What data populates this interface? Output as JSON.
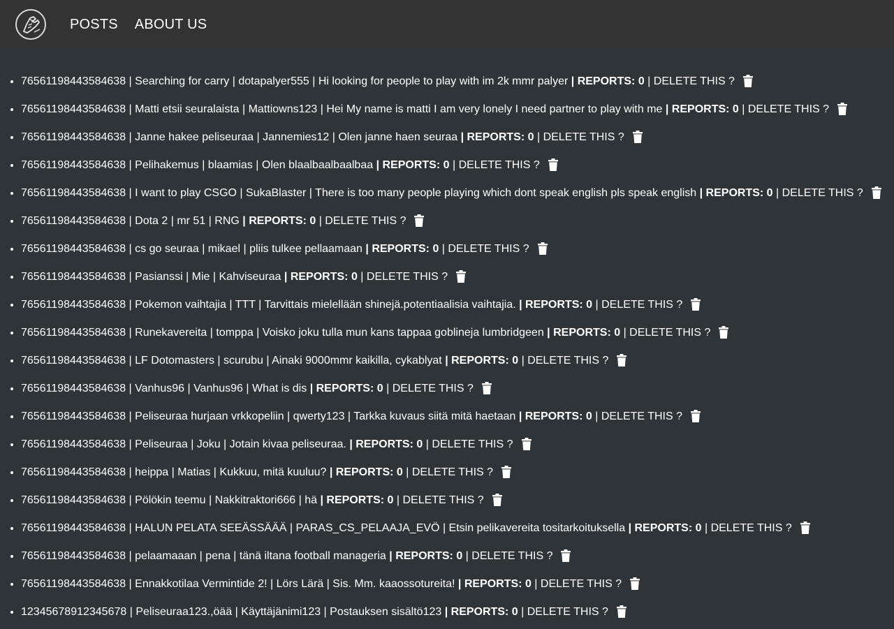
{
  "nav": {
    "logo_icon": "arm-wrestling-handshake-logo",
    "links": [
      "POSTS",
      "ABOUT US"
    ]
  },
  "labels": {
    "reports_prefix": "| REPORTS: ",
    "delete_text": " | DELETE THIS ?",
    "separator": " | "
  },
  "posts": [
    {
      "id": "76561198443584638",
      "title": "Searching for carry",
      "user": "dotapalyer555",
      "content": "Hi looking for people to play with im 2k mmr palyer",
      "reports": "0"
    },
    {
      "id": "76561198443584638",
      "title": "Matti etsii seuralaista",
      "user": "Mattiowns123",
      "content": "Hei My name is matti I am very lonely I need partner to play with me",
      "reports": "0"
    },
    {
      "id": "76561198443584638",
      "title": "Janne hakee peliseuraa",
      "user": "Jannemies12",
      "content": "Olen janne haen seuraa",
      "reports": "0"
    },
    {
      "id": "76561198443584638",
      "title": "Pelihakemus",
      "user": "blaamias",
      "content": "Olen blaalbaalbaalbaa",
      "reports": "0"
    },
    {
      "id": "76561198443584638",
      "title": "I want to play CSGO",
      "user": "SukaBlaster",
      "content": "There is too many people playing which dont speak english pls speak english",
      "reports": "0"
    },
    {
      "id": "76561198443584638",
      "title": "Dota 2",
      "user": "mr 51",
      "content": "RNG",
      "reports": "0"
    },
    {
      "id": "76561198443584638",
      "title": "cs go seuraa",
      "user": "mikael",
      "content": "pliis tulkee pellaamaan",
      "reports": "0"
    },
    {
      "id": "76561198443584638",
      "title": "Pasianssi",
      "user": "Mie",
      "content": "Kahviseuraa",
      "reports": "0"
    },
    {
      "id": "76561198443584638",
      "title": "Pokemon vaihtajia",
      "user": "TTT",
      "content": "Tarvittais mielellään shinejä.potentiaalisia vaihtajia.",
      "reports": "0"
    },
    {
      "id": "76561198443584638",
      "title": "Runekavereita",
      "user": "tomppa",
      "content": "Voisko joku tulla mun kans tappaa goblineja lumbridgeen",
      "reports": "0"
    },
    {
      "id": "76561198443584638",
      "title": "LF Dotomasters",
      "user": "scurubu",
      "content": "Ainaki 9000mmr kaikilla, cykablyat",
      "reports": "0"
    },
    {
      "id": "76561198443584638",
      "title": "Vanhus96",
      "user": "Vanhus96",
      "content": "What is dis",
      "reports": "0"
    },
    {
      "id": "76561198443584638",
      "title": "Peliseuraa hurjaan vrkkopeliin",
      "user": "qwerty123",
      "content": "Tarkka kuvaus siitä mitä haetaan",
      "reports": "0"
    },
    {
      "id": "76561198443584638",
      "title": "Peliseuraa",
      "user": "Joku",
      "content": "Jotain kivaa peliseuraa.",
      "reports": "0"
    },
    {
      "id": "76561198443584638",
      "title": "heippa",
      "user": "Matias",
      "content": "Kukkuu, mitä kuuluu?",
      "reports": "0"
    },
    {
      "id": "76561198443584638",
      "title": "Pölökin teemu",
      "user": "Nakkitraktori666",
      "content": "hä",
      "reports": "0"
    },
    {
      "id": "76561198443584638",
      "title": "HALUN PELATA SEEÄSSÄÄÄ",
      "user": "PARAS_CS_PELAAJA_EVÖ",
      "content": "Etsin pelikavereita tositarkoituksella",
      "reports": "0"
    },
    {
      "id": "76561198443584638",
      "title": "pelaamaaan",
      "user": "pena",
      "content": "tänä iltana football manageria",
      "reports": "0"
    },
    {
      "id": "76561198443584638",
      "title": "Ennakkotilaa Vermintide 2!",
      "user": "Lörs Lärä",
      "content": "Sis. Mm. kaaossotureita!",
      "reports": "0"
    },
    {
      "id": "12345678912345678",
      "title": "Peliseuraa123.,öää",
      "user": "Käyttäjänimi123",
      "content": "Postauksen sisältö123",
      "reports": "0"
    }
  ]
}
